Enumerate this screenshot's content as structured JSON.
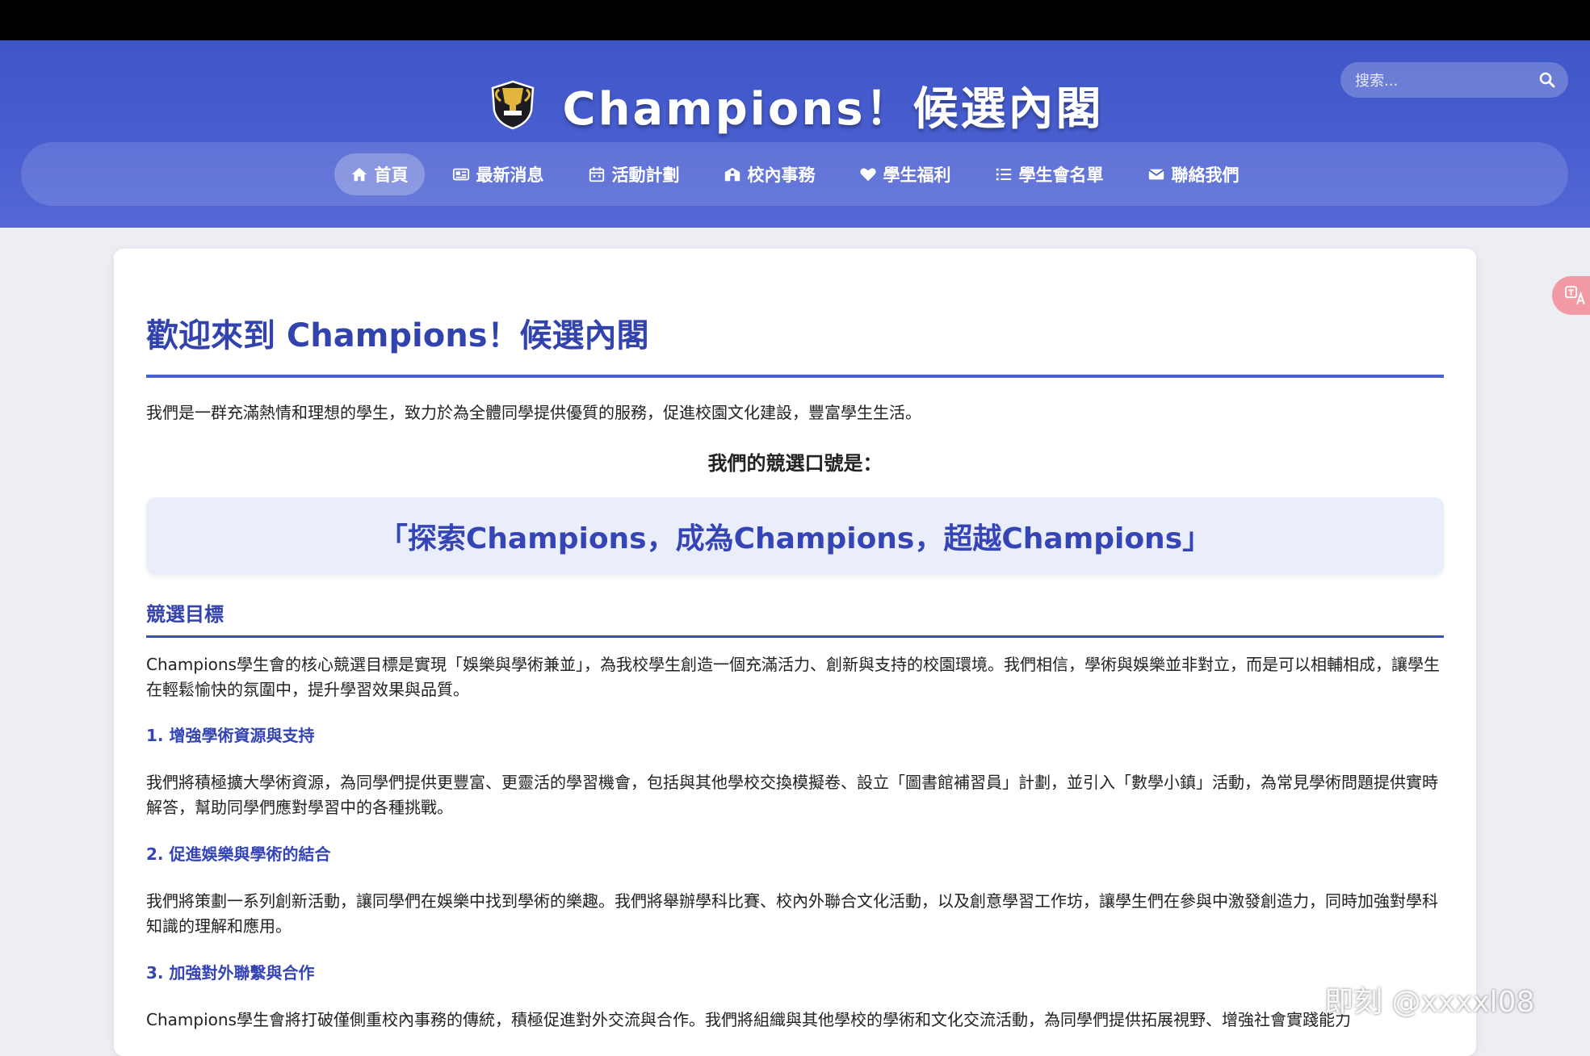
{
  "site": {
    "title": "Champions！候選內閣",
    "search_placeholder": "搜索..."
  },
  "nav": {
    "items": [
      {
        "label": "首頁",
        "icon": "home-icon",
        "active": true
      },
      {
        "label": "最新消息",
        "icon": "newspaper-icon"
      },
      {
        "label": "活動計劃",
        "icon": "calendar-icon"
      },
      {
        "label": "校內事務",
        "icon": "school-icon"
      },
      {
        "label": "學生福利",
        "icon": "heart-icon"
      },
      {
        "label": "學生會名單",
        "icon": "list-icon"
      },
      {
        "label": "聯絡我們",
        "icon": "envelope-icon"
      }
    ]
  },
  "main": {
    "welcome_title": "歡迎來到 Champions！候選內閣",
    "intro": "我們是一群充滿熱情和理想的學生，致力於為全體同學提供優質的服務，促進校園文化建設，豐富學生生活。",
    "slogan_label": "我們的競選口號是：",
    "slogan": "「探索Champions，成為Champions，超越Champions」",
    "section_title": "競選目標",
    "section_intro": "Champions學生會的核心競選目標是實現「娛樂與學術兼並」，為我校學生創造一個充滿活力、創新與支持的校園環境。我們相信，學術與娛樂並非對立，而是可以相輔相成，讓學生在輕鬆愉快的氛圍中，提升學習效果與品質。",
    "goals": [
      {
        "title": "1. 增強學術資源與支持",
        "text": "我們將積極擴大學術資源，為同學們提供更豐富、更靈活的學習機會，包括與其他學校交換模擬卷、設立「圖書館補習員」計劃，並引入「數學小鎮」活動，為常見學術問題提供實時解答，幫助同學們應對學習中的各種挑戰。"
      },
      {
        "title": "2. 促進娛樂與學術的結合",
        "text": "我們將策劃一系列創新活動，讓同學們在娛樂中找到學術的樂趣。我們將舉辦學科比賽、校內外聯合文化活動，以及創意學習工作坊，讓學生們在參與中激發創造力，同時加強對學科知識的理解和應用。"
      },
      {
        "title": "3. 加強對外聯繫與合作",
        "text": "Champions學生會將打破僅側重校內事務的傳統，積極促進對外交流與合作。我們將組織與其他學校的學術和文化交流活動，為同學們提供拓展視野、增強社會實踐能力"
      }
    ]
  },
  "overlay": {
    "translate_icon": "translate-icon",
    "watermark": "即刻 @xxxxl08"
  },
  "colors": {
    "header": "#4a5fd0",
    "accent": "#3343ad",
    "slogan_bg": "#eaedfa"
  }
}
